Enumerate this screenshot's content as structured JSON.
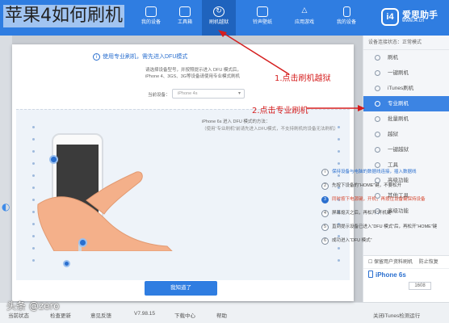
{
  "overlay_title": "苹果4如何刷机",
  "topnav": {
    "items": [
      {
        "label": "我的设备",
        "icon": "device-icon"
      },
      {
        "label": "工具箱",
        "icon": "toolbox-icon"
      },
      {
        "label": "刷机越狱",
        "icon": "flash-jailbreak-icon"
      },
      {
        "label": "铃声壁纸",
        "icon": "ringtone-icon"
      },
      {
        "label": "应用游戏",
        "icon": "apps-icon"
      },
      {
        "label": "我的设备",
        "icon": "my-device-icon"
      }
    ],
    "active_index": 2,
    "logo_name": "爱思助手",
    "logo_url": "www.i4.cn",
    "logo_glyph": "i4"
  },
  "modal": {
    "note": "使用专业刷机，需先进入DFU模式",
    "desc_line1": "请选择设备型号，并按照提示进入 DFU 模式后，",
    "desc_line2": "iPhone 4、3GS、3G等设备请使用专业模式刷机",
    "select_label": "当前设备：",
    "select_value": "iPhone 4s",
    "guide_head": "iPhone 6s 进入 DFU 模式的方法：",
    "guide_sub": "（使用“专业刷机”前请先进入DFU模式，不支持刷机的设备无法刷机）",
    "steps": [
      {
        "num": "i",
        "text": "保持设备与电脑的数据线连接，插入数据线"
      },
      {
        "num": "2",
        "text": "先按下设备的“HOME”键，不要松开"
      },
      {
        "num": "3",
        "text": "同时按下电源键，开机，再按住设备键保持设备"
      },
      {
        "num": "4",
        "text": "屏幕熄灭之后，再松开“开机键”"
      },
      {
        "num": "5",
        "text": "直到提示设备已进入“DFU 模式”后，再松开“HOME”键"
      },
      {
        "num": "6",
        "text": "成功进入“DFU 模式”"
      }
    ],
    "button_label": "我知道了"
  },
  "annotations": {
    "a1": "1.点击刷机越狱",
    "a2": "2.点击专业刷机"
  },
  "sidebar": {
    "header": "设备连接状态：正常模式",
    "items": [
      {
        "label": "刷机"
      },
      {
        "label": "一键刷机"
      },
      {
        "label": "iTunes刷机"
      },
      {
        "label": "专业刷机"
      },
      {
        "label": "批量刷机"
      },
      {
        "label": "越狱"
      },
      {
        "label": "一键越狱"
      },
      {
        "label": "工具"
      },
      {
        "label": "高级功能"
      },
      {
        "label": "其他工具"
      },
      {
        "label": "高级功能"
      }
    ],
    "active_index": 3,
    "check_label": "保留用户资料刷机",
    "check_right": "防止恢复",
    "device_name": "iPhone 6s",
    "device_code": "1608"
  },
  "statusbar": {
    "items": [
      "当前状态",
      "检查更新",
      "意见反馈",
      "V7.98.15",
      "下载中心",
      "帮助"
    ],
    "right_text": "关闭iTunes检测运行"
  },
  "watermark": "头条 @zero"
}
